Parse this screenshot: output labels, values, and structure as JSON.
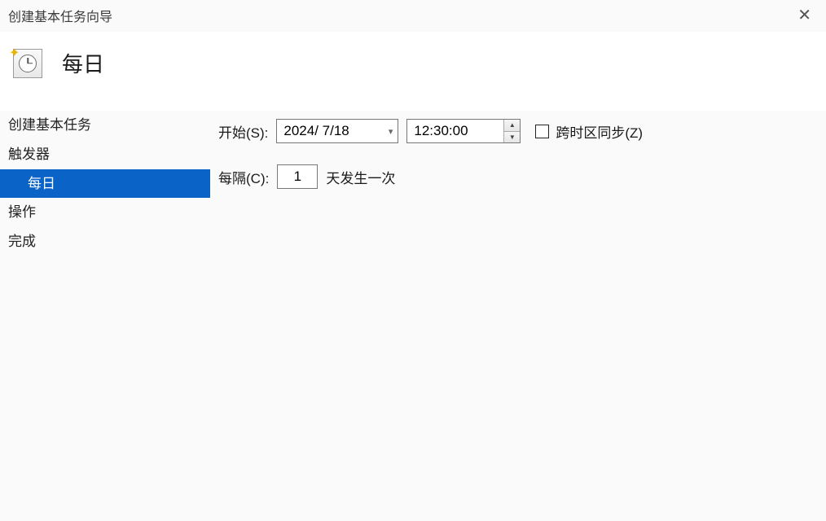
{
  "window": {
    "title": "创建基本任务向导"
  },
  "page": {
    "heading": "每日"
  },
  "sidebar": {
    "items": [
      {
        "label": "创建基本任务",
        "key": "create",
        "indent": false,
        "selected": false
      },
      {
        "label": "触发器",
        "key": "trigger",
        "indent": false,
        "selected": false
      },
      {
        "label": "每日",
        "key": "daily",
        "indent": true,
        "selected": true
      },
      {
        "label": "操作",
        "key": "action",
        "indent": false,
        "selected": false
      },
      {
        "label": "完成",
        "key": "finish",
        "indent": false,
        "selected": false
      }
    ]
  },
  "form": {
    "start_label": "开始(S):",
    "date_value": "2024/  7/18",
    "time_value": "12:30:00",
    "sync_label": "跨时区同步(Z)",
    "sync_checked": false,
    "recur_label": "每隔(C):",
    "recur_value": "1",
    "recur_suffix": "天发生一次"
  }
}
